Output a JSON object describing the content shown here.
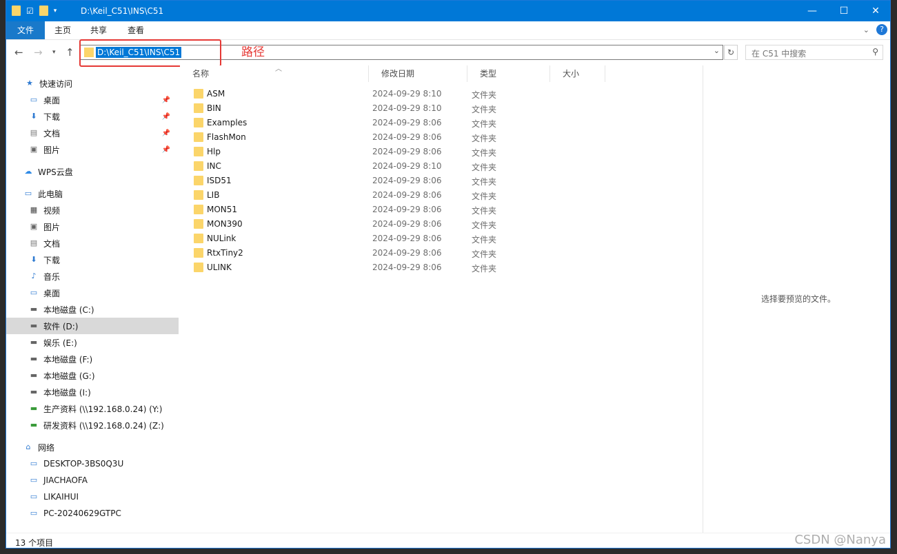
{
  "window": {
    "title": "D:\\Keil_C51\\INS\\C51",
    "controls": [
      "—",
      "☐",
      "✕"
    ]
  },
  "ribbon": {
    "tabs": [
      "文件",
      "主页",
      "共享",
      "查看"
    ]
  },
  "address": {
    "path": "D:\\Keil_C51\\INS\\C51"
  },
  "search": {
    "placeholder": "在 C51 中搜索"
  },
  "annotation": {
    "label": "路径",
    "color": "#e53935"
  },
  "sidebar": {
    "items": [
      {
        "label": "快速访问",
        "icon": "star-icon",
        "pinned": false
      },
      {
        "label": "桌面",
        "icon": "desktop-icon",
        "pinned": true
      },
      {
        "label": "下载",
        "icon": "download-icon",
        "pinned": true
      },
      {
        "label": "文档",
        "icon": "document-icon",
        "pinned": true
      },
      {
        "label": "图片",
        "icon": "picture-icon",
        "pinned": true
      },
      {
        "label": "WPS云盘",
        "icon": "cloud-icon",
        "pinned": false
      },
      {
        "label": "此电脑",
        "icon": "computer-icon",
        "pinned": false
      },
      {
        "label": "视频",
        "icon": "video-icon",
        "pinned": false
      },
      {
        "label": "图片",
        "icon": "picture-icon",
        "pinned": false
      },
      {
        "label": "文档",
        "icon": "document-icon",
        "pinned": false
      },
      {
        "label": "下载",
        "icon": "download-icon",
        "pinned": false
      },
      {
        "label": "音乐",
        "icon": "music-icon",
        "pinned": false
      },
      {
        "label": "桌面",
        "icon": "desktop-icon",
        "pinned": false
      },
      {
        "label": "本地磁盘 (C:)",
        "icon": "drive-icon",
        "pinned": false
      },
      {
        "label": "软件 (D:)",
        "icon": "drive-icon",
        "pinned": false,
        "selected": true
      },
      {
        "label": "娱乐 (E:)",
        "icon": "drive-icon",
        "pinned": false
      },
      {
        "label": "本地磁盘 (F:)",
        "icon": "drive-icon",
        "pinned": false
      },
      {
        "label": "本地磁盘 (G:)",
        "icon": "drive-icon",
        "pinned": false
      },
      {
        "label": "本地磁盘 (I:)",
        "icon": "drive-icon",
        "pinned": false
      },
      {
        "label": "生产资料 (\\\\192.168.0.24) (Y:)",
        "icon": "network-drive-icon",
        "pinned": false
      },
      {
        "label": "研发资料 (\\\\192.168.0.24) (Z:)",
        "icon": "network-drive-icon",
        "pinned": false
      },
      {
        "label": "网络",
        "icon": "network-icon",
        "pinned": false
      },
      {
        "label": "DESKTOP-3BS0Q3U",
        "icon": "computer-icon",
        "pinned": false
      },
      {
        "label": "JIACHAOFA",
        "icon": "computer-icon",
        "pinned": false
      },
      {
        "label": "LIKAIHUI",
        "icon": "computer-icon",
        "pinned": false
      },
      {
        "label": "PC-20240629GTPC",
        "icon": "computer-icon",
        "pinned": false
      }
    ]
  },
  "columns": [
    "名称",
    "修改日期",
    "类型",
    "大小"
  ],
  "files": [
    {
      "name": "ASM",
      "date": "2024-09-29 8:10",
      "type": "文件夹"
    },
    {
      "name": "BIN",
      "date": "2024-09-29 8:10",
      "type": "文件夹"
    },
    {
      "name": "Examples",
      "date": "2024-09-29 8:06",
      "type": "文件夹"
    },
    {
      "name": "FlashMon",
      "date": "2024-09-29 8:06",
      "type": "文件夹"
    },
    {
      "name": "Hlp",
      "date": "2024-09-29 8:06",
      "type": "文件夹"
    },
    {
      "name": "INC",
      "date": "2024-09-29 8:10",
      "type": "文件夹"
    },
    {
      "name": "ISD51",
      "date": "2024-09-29 8:06",
      "type": "文件夹"
    },
    {
      "name": "LIB",
      "date": "2024-09-29 8:06",
      "type": "文件夹"
    },
    {
      "name": "MON51",
      "date": "2024-09-29 8:06",
      "type": "文件夹"
    },
    {
      "name": "MON390",
      "date": "2024-09-29 8:06",
      "type": "文件夹"
    },
    {
      "name": "NULink",
      "date": "2024-09-29 8:06",
      "type": "文件夹"
    },
    {
      "name": "RtxTiny2",
      "date": "2024-09-29 8:06",
      "type": "文件夹"
    },
    {
      "name": "ULINK",
      "date": "2024-09-29 8:06",
      "type": "文件夹"
    }
  ],
  "preview": {
    "text": "选择要预览的文件。"
  },
  "status": {
    "count": "13 个项目"
  },
  "watermark": "CSDN @Nanya"
}
